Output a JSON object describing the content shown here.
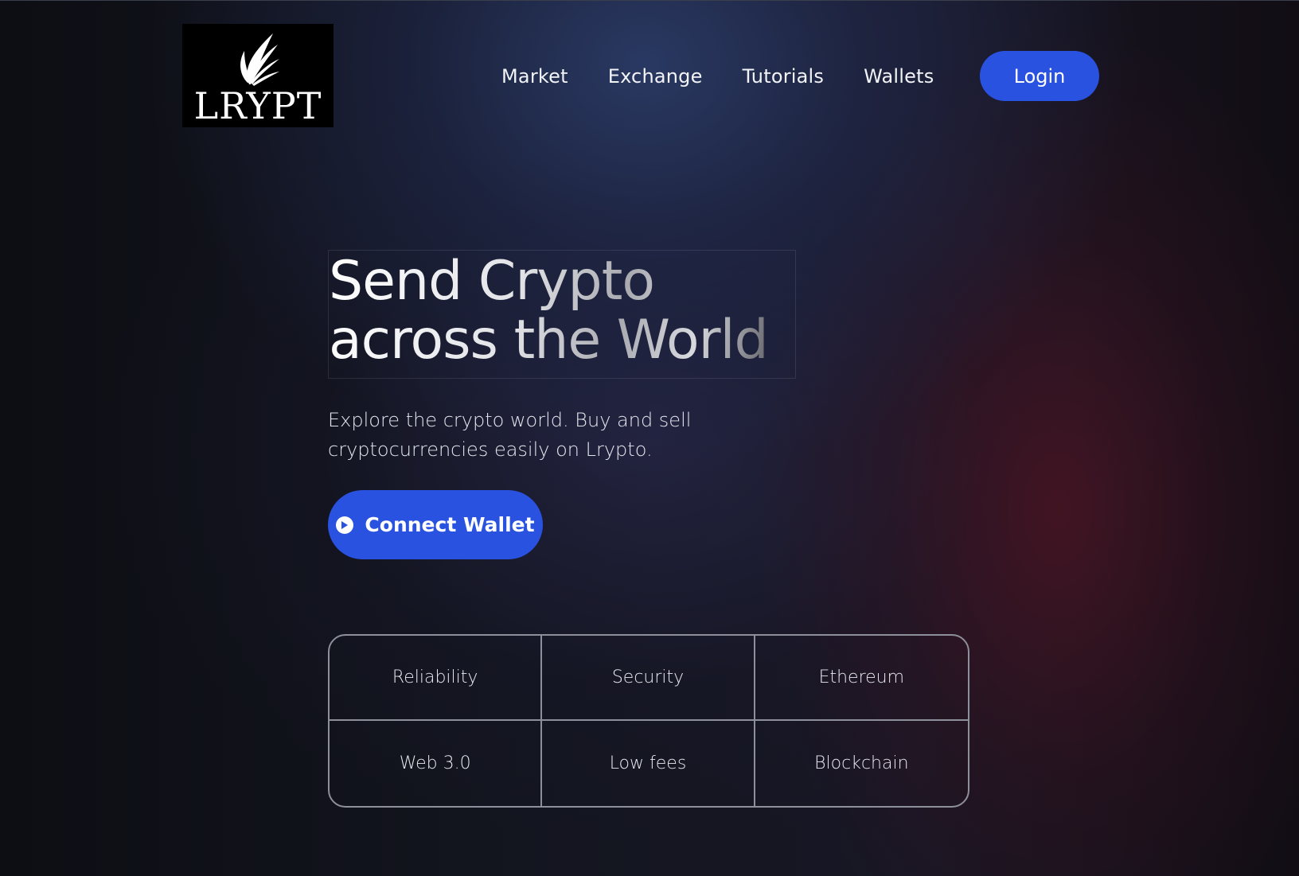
{
  "header": {
    "logo_text": "LRYPT",
    "nav": [
      "Market",
      "Exchange",
      "Tutorials",
      "Wallets"
    ],
    "login_label": "Login"
  },
  "hero": {
    "title_line1": "Send Crypto",
    "title_line2": "across the World",
    "subtitle_line1": "Explore the crypto world. Buy and sell",
    "subtitle_line2": "cryptocurrencies easily on Lrypto.",
    "connect_label": "Connect Wallet"
  },
  "features": [
    "Reliability",
    "Security",
    "Ethereum",
    "Web 3.0",
    "Low fees",
    "Blockchain"
  ],
  "colors": {
    "accent": "#2a52e0",
    "background": "#13151f",
    "grid_border": "#8d8f9a"
  },
  "icons": {
    "logo": "leaf-logo-icon",
    "connect": "play-circle-icon"
  }
}
